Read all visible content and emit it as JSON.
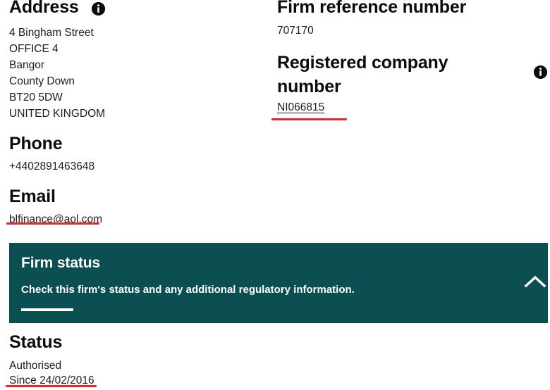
{
  "address": {
    "heading": "Address",
    "info_icon": "info-icon",
    "lines": [
      "4 Bingham Street",
      "OFFICE 4",
      "Bangor",
      "County Down",
      "BT20 5DW",
      "UNITED KINGDOM"
    ]
  },
  "phone": {
    "heading": "Phone",
    "value": "+4402891463648"
  },
  "email": {
    "heading": "Email",
    "value": "blfinance@aol.com"
  },
  "firm_reference": {
    "heading": "Firm reference number",
    "value": "707170"
  },
  "registered_company": {
    "heading": "Registered company number",
    "value": "NI066815",
    "info_icon": "info-icon"
  },
  "firm_status_banner": {
    "title": "Firm status",
    "subtitle": "Check this firm's status and any additional regulatory information.",
    "toggle_icon": "chevron-up-icon",
    "background_color": "#0b4f52"
  },
  "status": {
    "heading": "Status",
    "value": "Authorised",
    "since": "Since 24/02/2016"
  },
  "annotations": {
    "color": "#e8262c",
    "marks": [
      "email-underline",
      "registered-company-number-underline",
      "status-since-underline"
    ]
  }
}
